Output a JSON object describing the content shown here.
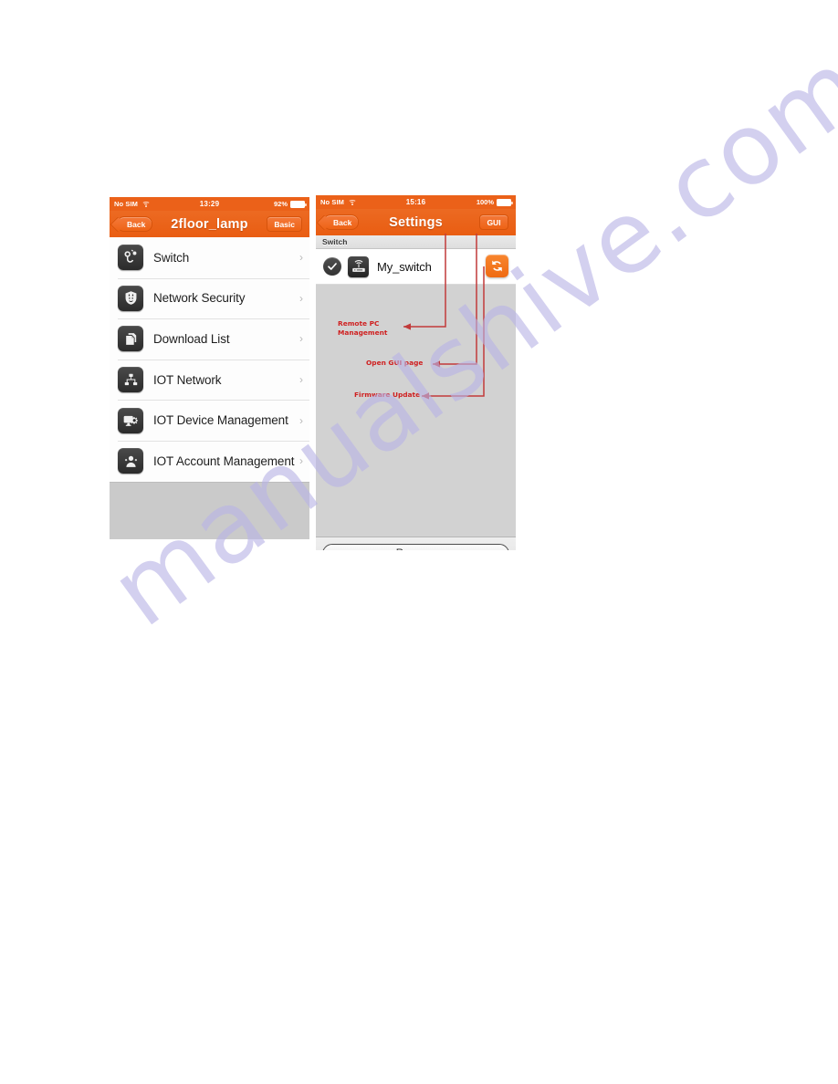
{
  "page": {
    "watermark": "manualshive.com",
    "watermark_color": "#b9b4e6",
    "background": "#ffffff"
  },
  "theme": {
    "accent_orange": "#eb6119",
    "nav_bar_orange": "#ec6a22",
    "annotation_red": "#cf2020",
    "icon_dark": "#2b2b2b",
    "filler_gray": "#cacaca",
    "panel_gray": "#d2d2d2"
  },
  "left_phone": {
    "status_bar": {
      "carrier": "No SIM",
      "wifi_icon": "wifi-icon",
      "time": "13:29",
      "battery_pct": "92%",
      "battery_icon": "battery-icon"
    },
    "nav": {
      "back_label": "Back",
      "title": "2floor_lamp",
      "right_label": "Basic"
    },
    "list_items": [
      {
        "label": "Switch",
        "icon": "power-plug-icon",
        "chevron": "›"
      },
      {
        "label": "Network Security",
        "icon": "shield-icon",
        "chevron": "›"
      },
      {
        "label": "Download List",
        "icon": "documents-icon",
        "chevron": "›"
      },
      {
        "label": "IOT Network",
        "icon": "network-topology-icon",
        "chevron": "›"
      },
      {
        "label": "IOT Device Management",
        "icon": "monitor-gear-icon",
        "chevron": "›"
      },
      {
        "label": "IOT Account Management",
        "icon": "user-group-icon",
        "chevron": "›"
      }
    ]
  },
  "right_phone": {
    "status_bar": {
      "carrier": "No SIM",
      "wifi_icon": "wifi-icon",
      "time": "15:16",
      "battery_pct": "100%",
      "battery_icon": "battery-icon"
    },
    "nav": {
      "back_label": "Back",
      "title": "Settings",
      "right_label": "GUI"
    },
    "section_header": "Switch",
    "device": {
      "name": "My_switch",
      "selected_icon": "check-circle-icon",
      "device_icon": "wifi-router-icon",
      "refresh_icon": "refresh-icon"
    },
    "bottom": {
      "rename_label": "Rename"
    }
  },
  "annotations": [
    {
      "id": "remote",
      "text": "Remote PC\nManagement",
      "points_to": "settings-title"
    },
    {
      "id": "gui",
      "text": "Open GUI page",
      "points_to": "gui-button"
    },
    {
      "id": "fw",
      "text": "Firmware Update",
      "points_to": "refresh-button"
    }
  ]
}
